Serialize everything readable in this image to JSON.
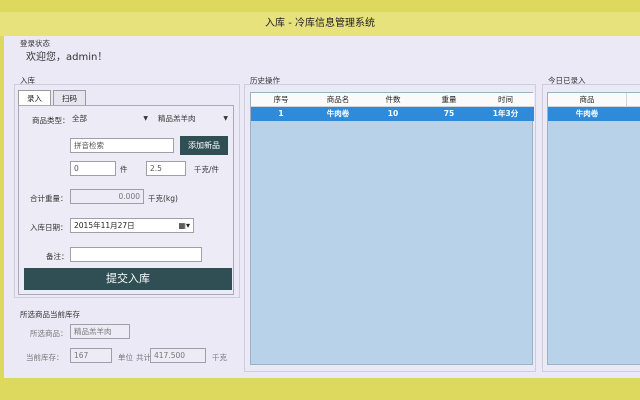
{
  "window": {
    "title": "入库 - 冷库信息管理系统"
  },
  "login": {
    "group_label": "登录状态",
    "welcome": "欢迎您，admin！"
  },
  "entry": {
    "section_label": "入库",
    "tabs": [
      {
        "label": "录入",
        "active": true
      },
      {
        "label": "扫码",
        "active": false
      }
    ],
    "product_type_label": "商品类型：",
    "product_type_value": "全部",
    "product_value": "精品羔羊肉",
    "pinyin_placeholder": "拼音检索",
    "add_new_label": "添加新品",
    "count_value": "0",
    "count_unit": "件",
    "per_unit_weight": "2.5",
    "per_unit_label": "千克/件",
    "total_weight_label": "合计重量：",
    "total_weight_value": "0.000",
    "total_weight_unit": "千克(kg)",
    "date_label": "入库日期：",
    "date_value": "2015年11月27日",
    "note_label": "备注：",
    "note_value": "",
    "submit_label": "提交入库"
  },
  "stock": {
    "section_label": "所选商品当前库存",
    "product_label": "所选商品：",
    "product_value": "精品羔羊肉",
    "stock_label": "当前库存：",
    "stock_value": "167",
    "unit_label": "单位",
    "total_label": "共计",
    "total_value": "417.500",
    "total_unit": "千克"
  },
  "history": {
    "section_label": "历史操作",
    "columns": [
      "序号",
      "商品名",
      "件数",
      "重量",
      "时间"
    ],
    "rows": [
      {
        "seq": "1",
        "name": "牛肉卷",
        "count": "10",
        "weight": "75",
        "time": "1年3分"
      }
    ]
  },
  "today": {
    "section_label": "今日已录入",
    "columns": [
      "商品"
    ],
    "rows": [
      {
        "name": "牛肉卷"
      }
    ]
  },
  "colors": {
    "accent": "#2f8ad9",
    "button": "#2f4f55",
    "grid_bg": "#b8d2ea",
    "title_bar": "#e7e27c"
  }
}
